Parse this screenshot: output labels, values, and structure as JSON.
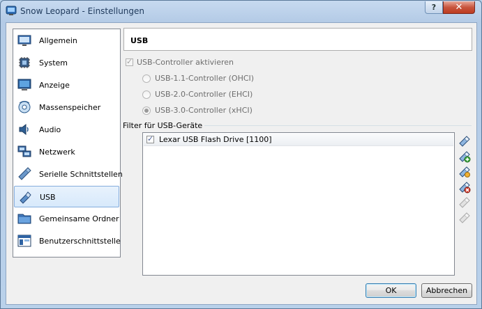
{
  "window": {
    "title": "Snow Leopard - Einstellungen",
    "help_label": "?",
    "close_label": "✕"
  },
  "sidebar": {
    "items": [
      {
        "label": "Allgemein",
        "icon": "monitor-icon"
      },
      {
        "label": "System",
        "icon": "chip-icon"
      },
      {
        "label": "Anzeige",
        "icon": "display-icon"
      },
      {
        "label": "Massenspeicher",
        "icon": "disc-icon"
      },
      {
        "label": "Audio",
        "icon": "speaker-icon"
      },
      {
        "label": "Netzwerk",
        "icon": "network-icon"
      },
      {
        "label": "Serielle Schnittstellen",
        "icon": "serial-port-icon"
      },
      {
        "label": "USB",
        "icon": "usb-icon",
        "selected": true
      },
      {
        "label": "Gemeinsame Ordner",
        "icon": "folder-icon"
      },
      {
        "label": "Benutzerschnittstelle",
        "icon": "ui-window-icon"
      }
    ]
  },
  "header": {
    "title": "USB"
  },
  "usb": {
    "enable_label": "USB-Controller aktivieren",
    "enable_checked": true,
    "controllers": [
      {
        "label": "USB-1.1-Controller (OHCI)",
        "selected": false
      },
      {
        "label": "USB-2.0-Controller (EHCI)",
        "selected": false
      },
      {
        "label": "USB-3.0-Controller (xHCI)",
        "selected": true
      }
    ],
    "filter_title": "Filter für USB-Geräte",
    "filters": [
      {
        "label": "Lexar USB Flash Drive [1100]",
        "checked": true
      }
    ],
    "tools": [
      {
        "name": "add-empty-filter-icon",
        "enabled": true
      },
      {
        "name": "add-filter-from-device-icon",
        "enabled": true
      },
      {
        "name": "edit-filter-icon",
        "enabled": true
      },
      {
        "name": "remove-filter-icon",
        "enabled": true
      },
      {
        "name": "move-filter-up-icon",
        "enabled": false
      },
      {
        "name": "move-filter-down-icon",
        "enabled": false
      }
    ]
  },
  "buttons": {
    "ok": "OK",
    "cancel": "Abbrechen"
  },
  "colors": {
    "selection": "#d7e9fb",
    "selection_border": "#84acdd",
    "titlebar": "#b9d1ea"
  }
}
